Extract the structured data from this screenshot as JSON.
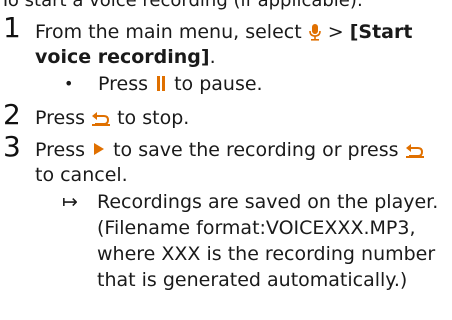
{
  "doc": {
    "intro": "To start a voice recording (if applicable):",
    "steps": [
      {
        "number": "1",
        "line1_pre": "From the main menu, select",
        "line1_sep": ">",
        "line1_bracket": "[Start",
        "line2_bracket": "voice recording]",
        "line2_post": ".",
        "sub_bullet": "•",
        "sub_pre": "Press",
        "sub_post": "to pause."
      },
      {
        "number": "2",
        "pre": "Press",
        "post": "to stop."
      },
      {
        "number": "3",
        "line1_pre": "Press",
        "line1_mid": "to save the recording or press",
        "line2": "to cancel.",
        "result_arrow": "↦",
        "result_lines": [
          "Recordings are saved on the player.",
          "(Filename format:VOICEXXX.MP3,",
          "where XXX is the recording number",
          "that is generated automatically.)"
        ]
      }
    ]
  },
  "icons": {
    "mic": "microphone-icon",
    "pause": "pause-icon",
    "back": "back-arrow-icon",
    "play": "play-icon",
    "accent_color": "#e07000"
  }
}
